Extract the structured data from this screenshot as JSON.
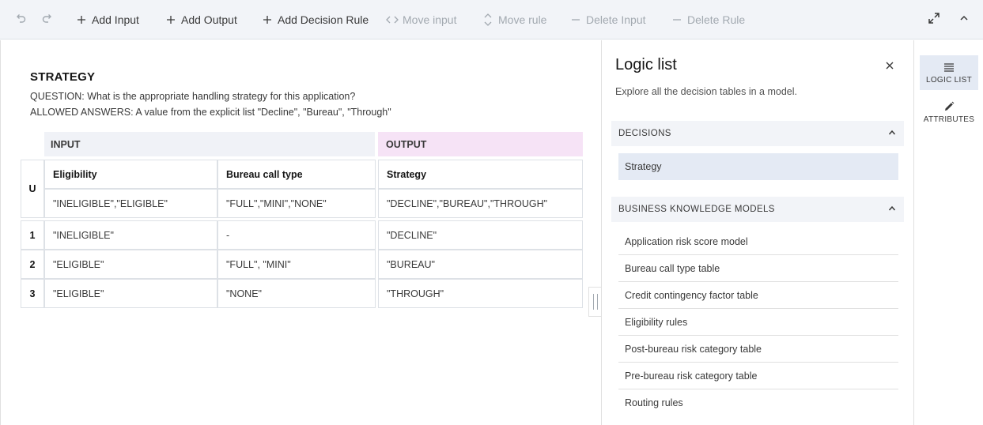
{
  "toolbar": {
    "add_input": "Add Input",
    "add_output": "Add Output",
    "add_decision_rule": "Add Decision Rule",
    "move_input": "Move input",
    "move_rule": "Move rule",
    "delete_input": "Delete Input",
    "delete_rule": "Delete Rule"
  },
  "table": {
    "title": "STRATEGY",
    "question": "QUESTION: What is the appropriate handling strategy for this application?",
    "allowed_answers": "ALLOWED ANSWERS: A value from the explicit list \"Decline\", \"Bureau\", \"Through\"",
    "input_header": "INPUT",
    "output_header": "OUTPUT",
    "hit_policy": "U",
    "columns": [
      {
        "name": "Eligibility",
        "allowed": "\"INELIGIBLE\",\"ELIGIBLE\""
      },
      {
        "name": "Bureau call type",
        "allowed": "\"FULL\",\"MINI\",\"NONE\""
      },
      {
        "name": "Strategy",
        "allowed": "\"DECLINE\",\"BUREAU\",\"THROUGH\""
      }
    ],
    "rules": [
      {
        "num": "1",
        "cells": [
          "\"INELIGIBLE\"",
          "-",
          "\"DECLINE\""
        ]
      },
      {
        "num": "2",
        "cells": [
          "\"ELIGIBLE\"",
          "\"FULL\", \"MINI\"",
          "\"BUREAU\""
        ]
      },
      {
        "num": "3",
        "cells": [
          "\"ELIGIBLE\"",
          "\"NONE\"",
          "\"THROUGH\""
        ]
      }
    ]
  },
  "panel": {
    "title": "Logic list",
    "description": "Explore all the decision tables in a model.",
    "decisions_header": "DECISIONS",
    "decisions": [
      "Strategy"
    ],
    "bkm_header": "BUSINESS KNOWLEDGE MODELS",
    "bkm_items": [
      "Application risk score model",
      "Bureau call type table",
      "Credit contingency factor table",
      "Eligibility rules",
      "Post-bureau risk category table",
      "Pre-bureau risk category table",
      "Routing rules"
    ]
  },
  "rail": {
    "logic_list": "LOGIC LIST",
    "attributes": "ATTRIBUTES"
  },
  "colors": {
    "toolbar_bg": "#f2f4f8",
    "input_header_bg": "#f0f2f7",
    "output_header_bg": "#f6e3f6",
    "selected_bg": "#e4eaf4"
  }
}
